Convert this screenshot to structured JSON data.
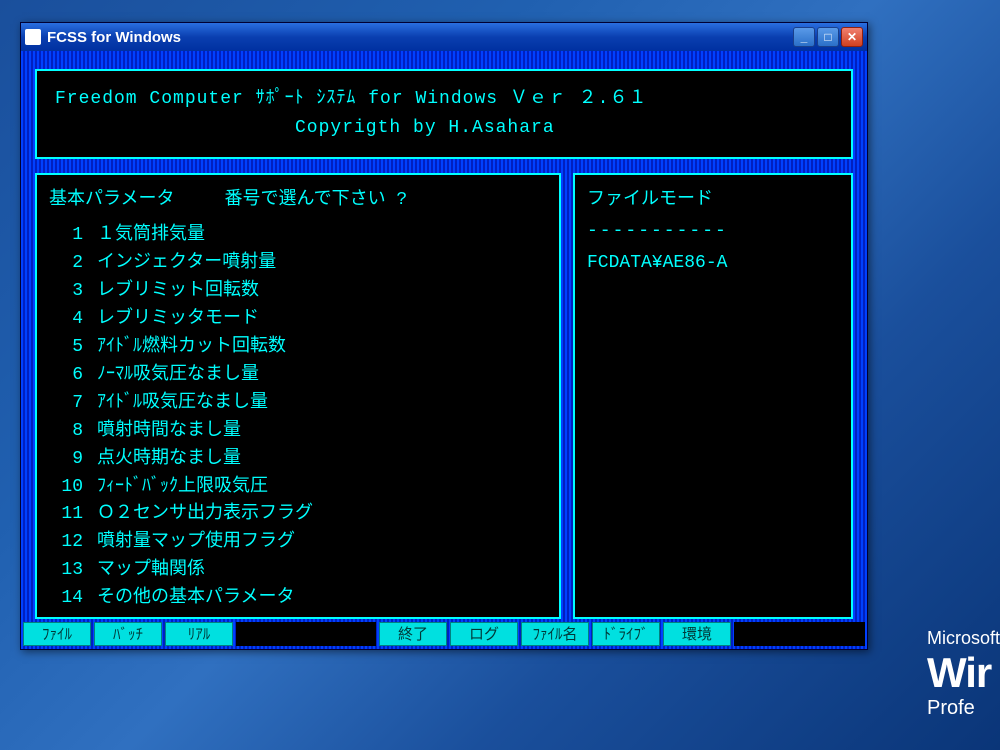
{
  "titlebar": {
    "title": "FCSS for Windows"
  },
  "header": {
    "line1": "Freedom Computer ｻﾎﾟｰﾄ ｼｽﾃﾑ for Windows  Ｖｅｒ  ２.６１",
    "line2": "Copyrigth by H.Asahara"
  },
  "left_panel": {
    "title": "基本パラメータ",
    "prompt": "番号で選んで下さい ?",
    "items": [
      {
        "num": "1",
        "label": "１気筒排気量"
      },
      {
        "num": "2",
        "label": "インジェクター噴射量"
      },
      {
        "num": "3",
        "label": "レブリミット回転数"
      },
      {
        "num": "4",
        "label": "レブリミッタモード"
      },
      {
        "num": "5",
        "label": "ｱｲﾄﾞﾙ燃料カット回転数"
      },
      {
        "num": "6",
        "label": "ﾉｰﾏﾙ吸気圧なまし量"
      },
      {
        "num": "7",
        "label": "ｱｲﾄﾞﾙ吸気圧なまし量"
      },
      {
        "num": "8",
        "label": "噴射時間なまし量"
      },
      {
        "num": "9",
        "label": "点火時期なまし量"
      },
      {
        "num": "10",
        "label": "ﾌｨｰﾄﾞﾊﾞｯｸ上限吸気圧"
      },
      {
        "num": "11",
        "label": "Ｏ２センサ出力表示フラグ"
      },
      {
        "num": "12",
        "label": "噴射量マップ使用フラグ"
      },
      {
        "num": "13",
        "label": "マップ軸関係"
      },
      {
        "num": "14",
        "label": "その他の基本パラメータ"
      }
    ]
  },
  "right_panel": {
    "title": "ファイルモード",
    "divider": "-----------",
    "path": "FCDATA¥AE86-A"
  },
  "bottom_buttons": {
    "b1": "ﾌｧｲﾙ",
    "b2": "ﾊﾞｯﾁ",
    "b3": "ﾘｱﾙ",
    "b4": "終了",
    "b5": "ログ",
    "b6": "ﾌｧｲﾙ名",
    "b7": "ﾄﾞﾗｲﾌﾞ",
    "b8": "環境"
  },
  "desktop": {
    "ms": "Microsoft",
    "win": "Wir",
    "prof": "Profe"
  }
}
